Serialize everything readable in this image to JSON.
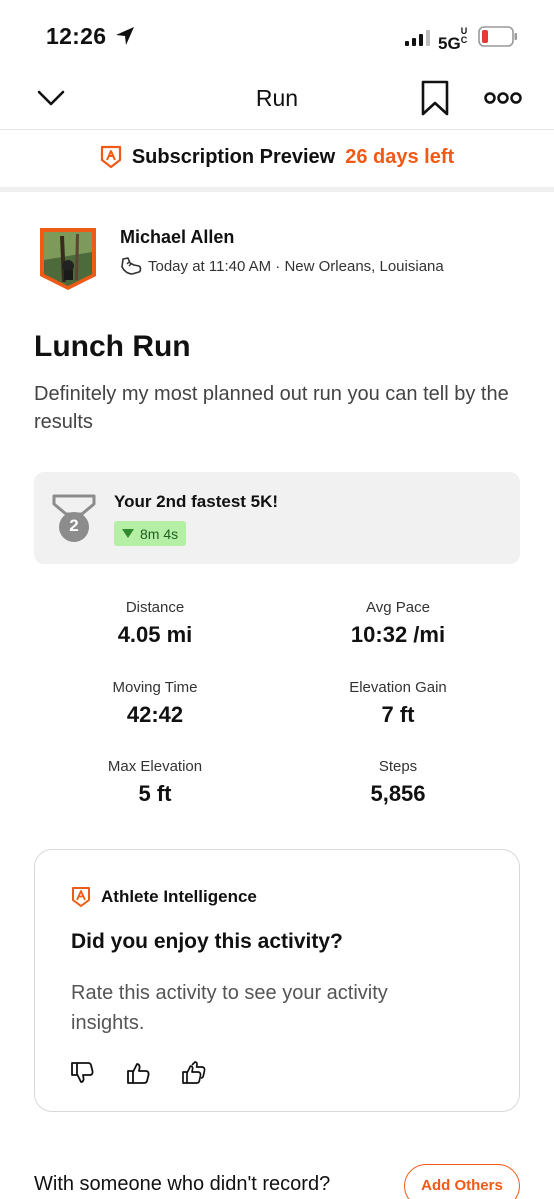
{
  "status_bar": {
    "time": "12:26",
    "network": "5G",
    "network_suffix": "UC",
    "battery_color": "#e53935"
  },
  "nav": {
    "title": "Run",
    "icons": [
      "chevron-down-icon",
      "bookmark-icon",
      "more-icon"
    ]
  },
  "subscription": {
    "label": "Subscription Preview",
    "days_left": "26 days left",
    "accent": "#f05a17"
  },
  "athlete": {
    "name": "Michael Allen",
    "meta": "Today at 11:40 AM · New Orleans, Louisiana"
  },
  "activity": {
    "title": "Lunch Run",
    "description": "Definitely my most planned out run you can tell by the results"
  },
  "achievement": {
    "rank": "2",
    "title": "Your 2nd fastest 5K!",
    "delta": "8m 4s"
  },
  "stats": [
    {
      "label": "Distance",
      "value": "4.05 mi"
    },
    {
      "label": "Avg Pace",
      "value": "10:32 /mi"
    },
    {
      "label": "Moving Time",
      "value": "42:42"
    },
    {
      "label": "Elevation Gain",
      "value": "7 ft"
    },
    {
      "label": "Max Elevation",
      "value": "5 ft"
    },
    {
      "label": "Steps",
      "value": "5,856"
    }
  ],
  "intelligence": {
    "heading": "Athlete Intelligence",
    "question": "Did you enjoy this activity?",
    "subtext": "Rate this activity to see your activity insights."
  },
  "footer": {
    "question": "With someone who didn't record?",
    "button": "Add Others"
  }
}
